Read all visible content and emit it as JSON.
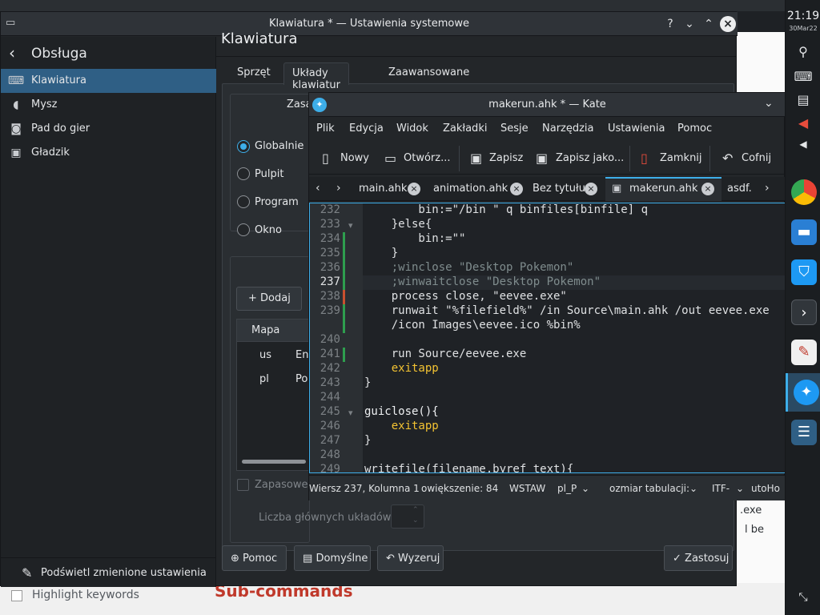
{
  "settings": {
    "title": "Klawiatura * — Ustawienia systemowe",
    "sidebar_back_label": "Obsługa",
    "sidebar_items": [
      {
        "label": "Klawiatura",
        "icon": "keyboard-icon"
      },
      {
        "label": "Mysz",
        "icon": "mouse-icon"
      },
      {
        "label": "Pad do gier",
        "icon": "gamepad-icon"
      },
      {
        "label": "Gładzik",
        "icon": "touchpad-icon"
      }
    ],
    "highlight_changed": "Podświetl zmienione ustawienia",
    "page_title": "Klawiatura",
    "tabs": [
      "Sprzęt",
      "Układy klawiatur",
      "Zaawansowane"
    ],
    "group_label": "Zasa",
    "radios": [
      "Globalnie",
      "Pulpit",
      "Program",
      "Okno"
    ],
    "add_button": "Dodaj",
    "table_header": "Mapa",
    "rows": [
      {
        "map": "us",
        "name": "En"
      },
      {
        "map": "pl",
        "name": "Po"
      }
    ],
    "spare_label": "Zapasowe",
    "main_count_label": "Liczba głównych układów:",
    "buttons": {
      "help": "Pomoc",
      "defaults": "Domyślne",
      "reset": "Wyzeruj",
      "apply": "Zastosuj"
    }
  },
  "kate": {
    "title": "makerun.ahk * — Kate",
    "menu": [
      "Plik",
      "Edycja",
      "Widok",
      "Zakładki",
      "Sesje",
      "Narzędzia",
      "Ustawienia",
      "Pomoc"
    ],
    "toolbar": {
      "new": "Nowy",
      "open": "Otwórz...",
      "save": "Zapisz",
      "save_as": "Zapisz jako...",
      "close": "Zamknij",
      "undo": "Cofnij"
    },
    "tabs": [
      "main.ahk",
      "animation.ahk",
      "Bez tytułu",
      "makerun.ahk",
      "asdf."
    ],
    "line_numbers": [
      "232",
      "233",
      "234",
      "235",
      "236",
      "237",
      "238",
      "239",
      "",
      "240",
      "241",
      "242",
      "243",
      "244",
      "245",
      "246",
      "247",
      "248",
      "249"
    ],
    "code": [
      "        bin:=\"/bin \" q binfiles[binfile] q",
      "    }else{",
      "        bin:=\"\"",
      "    }",
      "    ;winclose \"Desktop Pokemon\"",
      "    ;winwaitclose \"Desktop Pokemon\"",
      "    process close, \"eevee.exe\"",
      "    runwait \"%filefield%\" /in Source\\main.ahk /out eevee.exe",
      "    /icon Images\\eevee.ico %bin%",
      "",
      "    run Source/eevee.exe",
      "    exitapp",
      "}",
      "",
      "guiclose(){",
      "    exitapp",
      "}",
      "",
      "writefile(filename,byref text){"
    ],
    "status": {
      "position": "Wiersz 237, Kolumna 1",
      "zoom": "owiększenie: 84",
      "mode": "WSTAW",
      "lang": "pl_P",
      "tab": "ozmiar tabulacji:",
      "enc": "ITF-",
      "syntax": "utoHo"
    }
  },
  "panel": {
    "time": "21:19",
    "date": "30Mar22"
  },
  "background": {
    "snip1": ".exe",
    "snip2": "l be",
    "highlight": "Highlight keywords",
    "sub": "Sub-commands"
  }
}
